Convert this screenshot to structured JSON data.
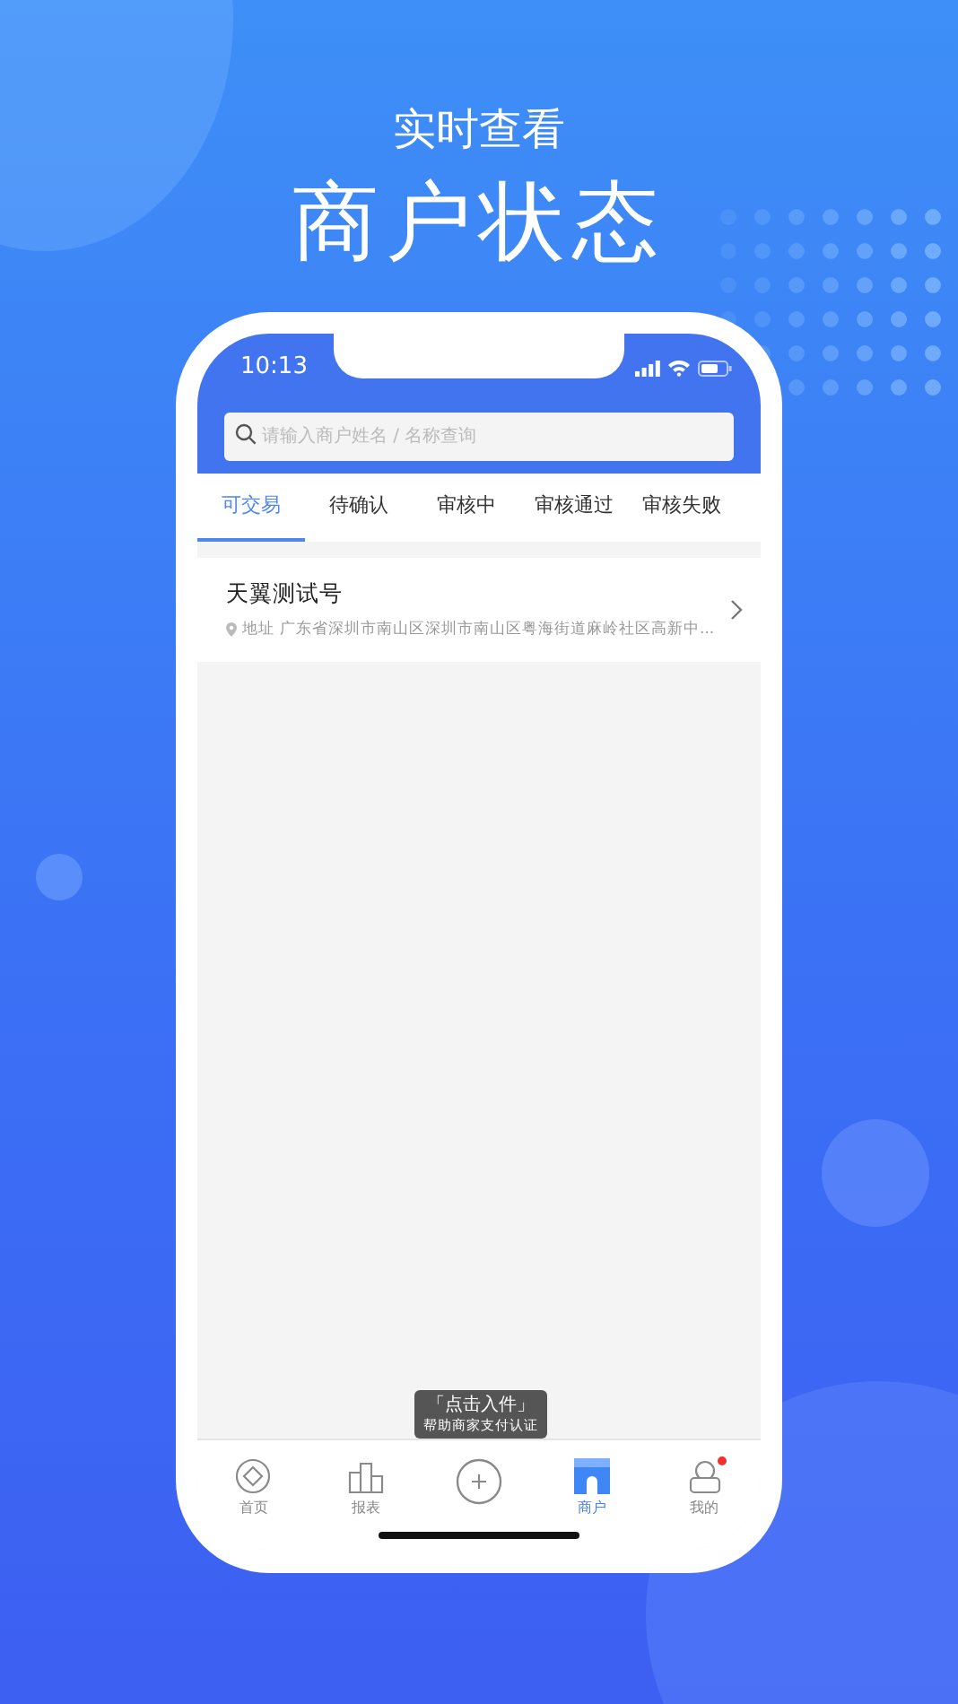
{
  "headline": {
    "subtitle": "实时查看",
    "title": "商户状态"
  },
  "status_bar": {
    "time": "10:13"
  },
  "search": {
    "placeholder": "请输入商户姓名 / 名称查询"
  },
  "tabs": [
    {
      "label": "可交易",
      "selected": true
    },
    {
      "label": "待确认",
      "selected": false
    },
    {
      "label": "审核中",
      "selected": false
    },
    {
      "label": "审核通过",
      "selected": false
    },
    {
      "label": "审核失败",
      "selected": false
    }
  ],
  "merchants": [
    {
      "name": "天翼测试号",
      "address_label": "地址",
      "address": "广东省深圳市南山区深圳市南山区粤海街道麻岭社区高新中..."
    }
  ],
  "tooltip": {
    "title": "「点击入件」",
    "text": "帮助商家支付认证"
  },
  "bottom_nav": [
    {
      "kind": "home",
      "label": "首页",
      "selected": false,
      "badge": false
    },
    {
      "kind": "report",
      "label": "报表",
      "selected": false,
      "badge": false
    },
    {
      "kind": "add",
      "selected": false,
      "badge": false
    },
    {
      "kind": "shop",
      "label": "商户",
      "selected": true,
      "badge": false
    },
    {
      "kind": "profile",
      "label": "我的",
      "selected": false,
      "badge": true
    }
  ]
}
